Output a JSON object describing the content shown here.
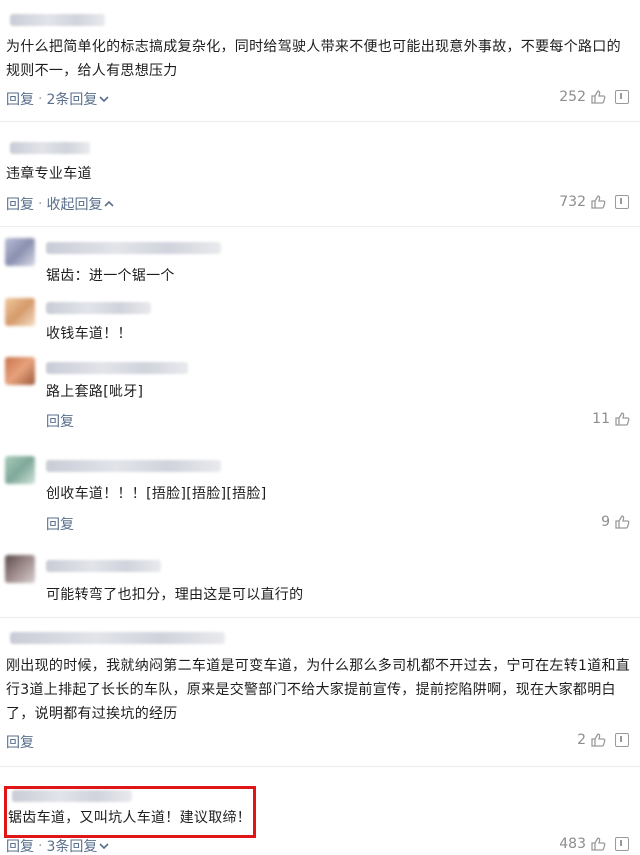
{
  "comments": [
    {
      "text": "为什么把简单化的标志搞成复杂化，同时给驾驶人带来不便也可能出现意外事故，不要每个路口的规则不一，给人有思想压力",
      "reply_label": "回复",
      "replies_label": "2条回复",
      "likes": "252"
    },
    {
      "text": "违章专业车道",
      "reply_label": "回复",
      "replies_label": "收起回复",
      "likes": "732",
      "replies": [
        {
          "text": "锯齿：进一个锯一个"
        },
        {
          "text": "收钱车道！！"
        },
        {
          "text": "路上套路[呲牙]",
          "reply_label": "回复",
          "likes": "11"
        },
        {
          "text": "创收车道！！！[捂脸][捂脸][捂脸]",
          "reply_label": "回复",
          "likes": "9"
        },
        {
          "text": "可能转弯了也扣分，理由这是可以直行的"
        }
      ]
    },
    {
      "text_lines": [
        "刚出现的时候，我就纳闷第二车道是可变车道，为什么那么多司机都不开过去，宁可在左转1道和直",
        "行3道上排起了长长的车队，原来是交警部门不给大家提前宣传，提前挖陷阱啊，现在大家都明白",
        "了，说明都有过挨坑的经历"
      ],
      "reply_label": "回复",
      "likes": "2"
    },
    {
      "text": "锯齿车道，又叫坑人车道！建议取缔！！",
      "reply_label": "回复",
      "replies_label": "3条回复",
      "likes": "483"
    }
  ],
  "icons": {
    "like": "thumbs-up-icon",
    "report": "report-icon",
    "expand": "chevron-down-icon",
    "collapse": "chevron-up-icon"
  },
  "colors": {
    "action": "#5a6f8c",
    "highlight": "#e01616"
  }
}
